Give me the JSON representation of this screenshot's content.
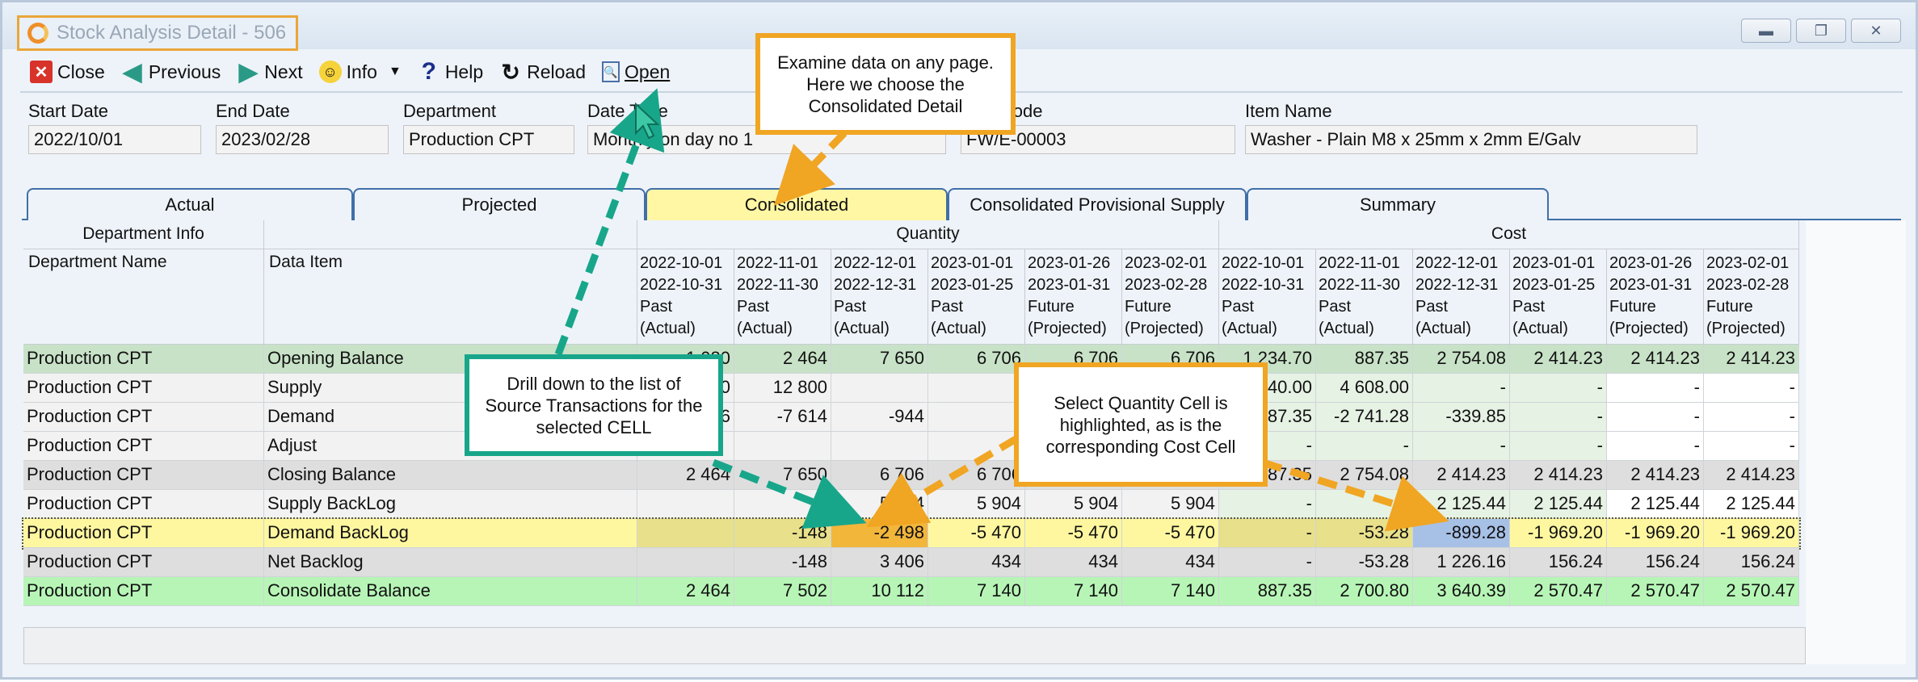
{
  "window": {
    "title": "Stock Analysis Detail - 506",
    "controls": [
      "minimize",
      "restore",
      "close"
    ]
  },
  "toolbar": {
    "close": "Close",
    "previous": "Previous",
    "next": "Next",
    "info": "Info",
    "help": "Help",
    "reload": "Reload",
    "open": "Open"
  },
  "filters": {
    "start_date": {
      "label": "Start Date",
      "value": "2022/10/01"
    },
    "end_date": {
      "label": "End Date",
      "value": "2023/02/28"
    },
    "department": {
      "label": "Department",
      "value": "Production CPT"
    },
    "date_type": {
      "label": "Date Type",
      "value": "Monthly on day no 1"
    },
    "item_code": {
      "label": "Item Code",
      "value": "FW/E-00003"
    },
    "item_name": {
      "label": "Item Name",
      "value": "Washer - Plain M8 x 25mm x 2mm E/Galv"
    }
  },
  "tabs": [
    {
      "label": "Actual"
    },
    {
      "label": "Projected"
    },
    {
      "label": "Consolidated",
      "active": true
    },
    {
      "label": "Consolidated Provisional Supply"
    },
    {
      "label": "Summary"
    }
  ],
  "grid": {
    "group_headers": {
      "dept_info": "Department Info",
      "quantity": "Quantity",
      "cost": "Cost"
    },
    "col_headers": {
      "dept_name": "Department Name",
      "data_item": "Data Item"
    },
    "period_headers": [
      [
        "2022-10-01",
        "2022-10-31",
        "Past",
        "(Actual)"
      ],
      [
        "2022-11-01",
        "2022-11-30",
        "Past",
        "(Actual)"
      ],
      [
        "2022-12-01",
        "2022-12-31",
        "Past",
        "(Actual)"
      ],
      [
        "2023-01-01",
        "2023-01-25",
        "Past",
        "(Actual)"
      ],
      [
        "2023-01-26",
        "2023-01-31",
        "Future",
        "(Projected)"
      ],
      [
        "2023-02-01",
        "2023-02-28",
        "Future",
        "(Projected)"
      ],
      [
        "2022-10-01",
        "2022-10-31",
        "Past",
        "(Actual)"
      ],
      [
        "2022-11-01",
        "2022-11-30",
        "Past",
        "(Actual)"
      ],
      [
        "2022-12-01",
        "2022-12-31",
        "Past",
        "(Actual)"
      ],
      [
        "2023-01-01",
        "2023-01-25",
        "Past",
        "(Actual)"
      ],
      [
        "2023-01-26",
        "2023-01-31",
        "Future",
        "(Projected)"
      ],
      [
        "2023-02-01",
        "2023-02-28",
        "Future",
        "(Projected)"
      ]
    ],
    "rows": [
      {
        "dept": "Production CPT",
        "item": "Opening Balance",
        "style": "opening",
        "q": [
          "1 080",
          "2 464",
          "7 650",
          "6 706",
          "6 706",
          "6 706"
        ],
        "c": [
          "1 234.70",
          "887.35",
          "2 754.08",
          "2 414.23",
          "2 414.23",
          "2 414.23"
        ]
      },
      {
        "dept": "Production CPT",
        "item": "Supply",
        "style": "plain",
        "q": [
          "1 500",
          "12 800",
          "",
          "",
          "",
          ""
        ],
        "c": [
          "840.00",
          "4 608.00",
          "-",
          "-",
          "-",
          "-"
        ]
      },
      {
        "dept": "Production CPT",
        "item": "Demand",
        "style": "plain",
        "q": [
          "-116",
          "-7 614",
          "-944",
          "",
          "",
          ""
        ],
        "c": [
          "-887.35",
          "-2 741.28",
          "-339.85",
          "-",
          "-",
          "-"
        ]
      },
      {
        "dept": "Production CPT",
        "item": "Adjust",
        "style": "plain",
        "q": [
          "",
          "",
          "",
          "",
          "",
          ""
        ],
        "c": [
          "-",
          "-",
          "-",
          "-",
          "-",
          "-"
        ]
      },
      {
        "dept": "Production CPT",
        "item": "Closing Balance",
        "style": "closing",
        "q": [
          "2 464",
          "7 650",
          "6 706",
          "6 706",
          "6 706",
          "6 706"
        ],
        "c": [
          "887.35",
          "2 754.08",
          "2 414.23",
          "2 414.23",
          "2 414.23",
          "2 414.23"
        ]
      },
      {
        "dept": "Production CPT",
        "item": "Supply BackLog",
        "style": "plain",
        "q": [
          "",
          "",
          "5 904",
          "5 904",
          "5 904",
          "5 904"
        ],
        "c": [
          "-",
          "",
          "2 125.44",
          "2 125.44",
          "2 125.44",
          "2 125.44"
        ]
      },
      {
        "dept": "Production CPT",
        "item": "Demand BackLog",
        "style": "selected",
        "q": [
          "",
          "-148",
          "-2 498",
          "-5 470",
          "-5 470",
          "-5 470"
        ],
        "c": [
          "-",
          "-53.28",
          "-899.28",
          "-1 969.20",
          "-1 969.20",
          "-1 969.20"
        ]
      },
      {
        "dept": "Production CPT",
        "item": "Net Backlog",
        "style": "closing",
        "q": [
          "",
          "-148",
          "3 406",
          "434",
          "434",
          "434"
        ],
        "c": [
          "-",
          "-53.28",
          "1 226.16",
          "156.24",
          "156.24",
          "156.24"
        ]
      },
      {
        "dept": "Production CPT",
        "item": "Consolidate Balance",
        "style": "consolidate",
        "q": [
          "2 464",
          "7 502",
          "10 112",
          "7 140",
          "7 140",
          "7 140"
        ],
        "c": [
          "887.35",
          "2 700.80",
          "3 640.39",
          "2 570.47",
          "2 570.47",
          "2 570.47"
        ]
      }
    ]
  },
  "callouts": {
    "examine": "Examine data on any page.\nHere we choose the\nConsolidated Detail",
    "drill": "Drill down to the list of\nSource Transactions for the\nselected CELL",
    "select": "Select Quantity Cell is\nhighlighted, as is the\ncorresponding Cost Cell"
  },
  "colors": {
    "opening": "#c8e2c8",
    "closing": "#dedede",
    "plain": "#f2f2f2",
    "selected": "#fff7a0",
    "consolidate": "#b7f5b7",
    "qty_selected_cell": "#f2b63b",
    "cost_selected_cell": "#a7c0e6",
    "cost_green": "#e6f2e4",
    "orange": "#f0a523",
    "teal": "#18a68a"
  }
}
